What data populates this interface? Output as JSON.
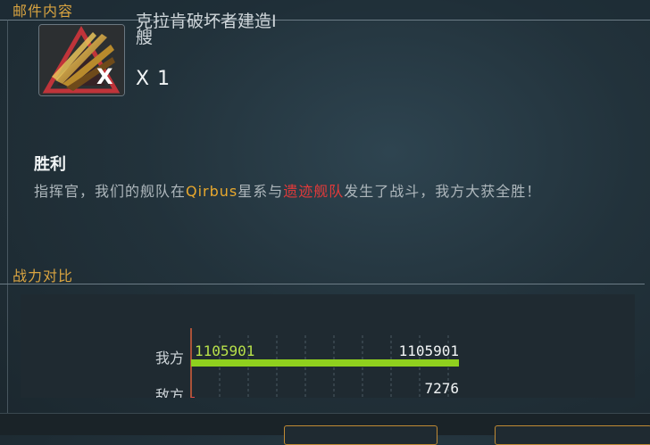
{
  "mail": {
    "section_title": "邮件内容"
  },
  "item": {
    "name_line1": "克拉肯破坏者建造I",
    "name_line2": "艘",
    "count": "X 1",
    "icon_badge": "X"
  },
  "report": {
    "title": "胜利",
    "msg_prefix": "指挥官，我们的舰队在",
    "system": "Qirbus",
    "msg_mid": "星系与",
    "enemy": "遗迹舰队",
    "msg_suffix": "发生了战斗，我方大获全胜！"
  },
  "power": {
    "section_title": "战力对比"
  },
  "chart_data": {
    "type": "bar",
    "orientation": "horizontal",
    "categories": [
      "我方",
      "敌方"
    ],
    "series": [
      {
        "values": [
          1105901,
          7276
        ]
      }
    ],
    "bar_labels": [
      {
        "start": "1105901",
        "end": "1105901"
      },
      {
        "start": "0",
        "end": "7276"
      }
    ],
    "colors": {
      "ours": "#8fd01e",
      "enemy": "#e04a4a",
      "axis": "#d9603a"
    }
  }
}
